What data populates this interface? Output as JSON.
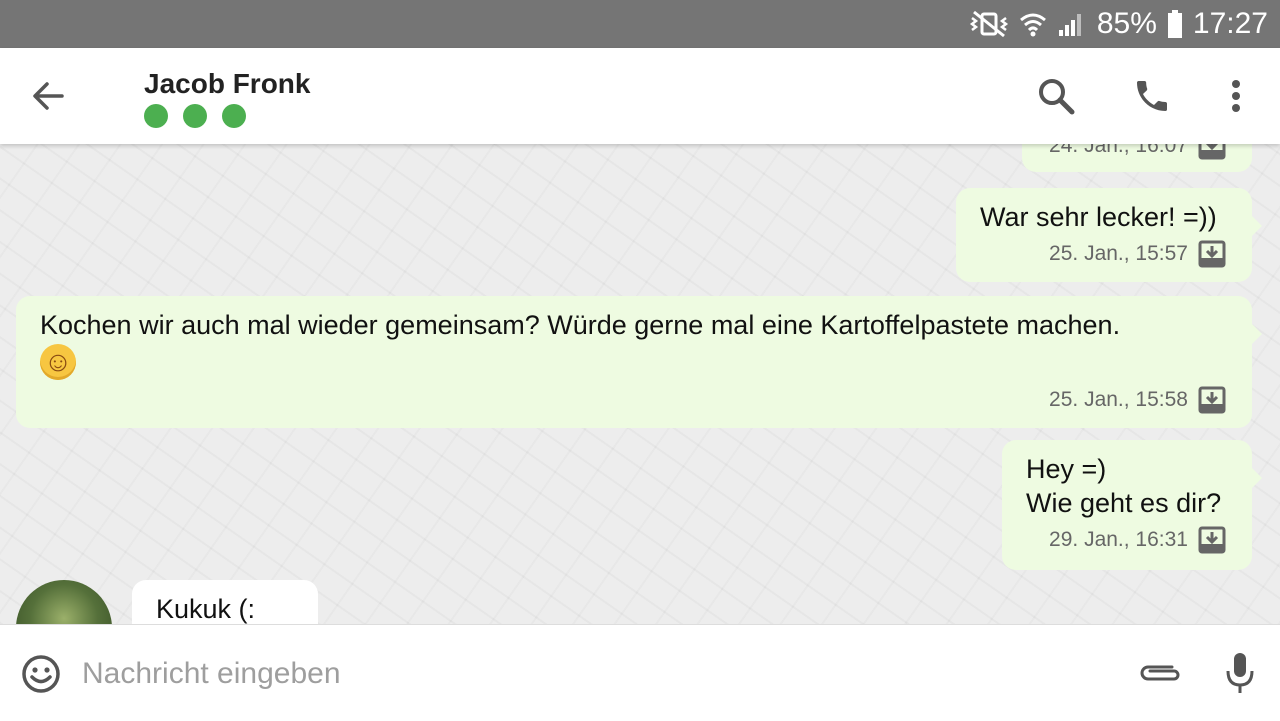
{
  "status_bar": {
    "battery": "85%",
    "time": "17:27"
  },
  "header": {
    "contact_name": "Jacob Fronk",
    "status_dots": 3,
    "status_color": "#4caf50"
  },
  "messages": [
    {
      "direction": "outgoing",
      "text": "",
      "timestamp": "24. Jan., 16:07"
    },
    {
      "direction": "outgoing",
      "text": "War sehr lecker! =))",
      "timestamp": "25. Jan., 15:57"
    },
    {
      "direction": "outgoing",
      "text": "Kochen wir auch mal wieder gemeinsam? Würde gerne mal eine Kartoffelpastete machen.",
      "emoji": "☺",
      "timestamp": "25. Jan., 15:58"
    },
    {
      "direction": "outgoing",
      "lines": [
        "Hey =)",
        "Wie geht es dir?"
      ],
      "timestamp": "29. Jan., 16:31"
    },
    {
      "direction": "incoming",
      "text": "Kukuk (:"
    }
  ],
  "composer": {
    "placeholder": "Nachricht eingeben"
  },
  "colors": {
    "outgoing_bubble": "#eefbe1",
    "incoming_bubble": "#ffffff",
    "accent": "#4caf50"
  }
}
